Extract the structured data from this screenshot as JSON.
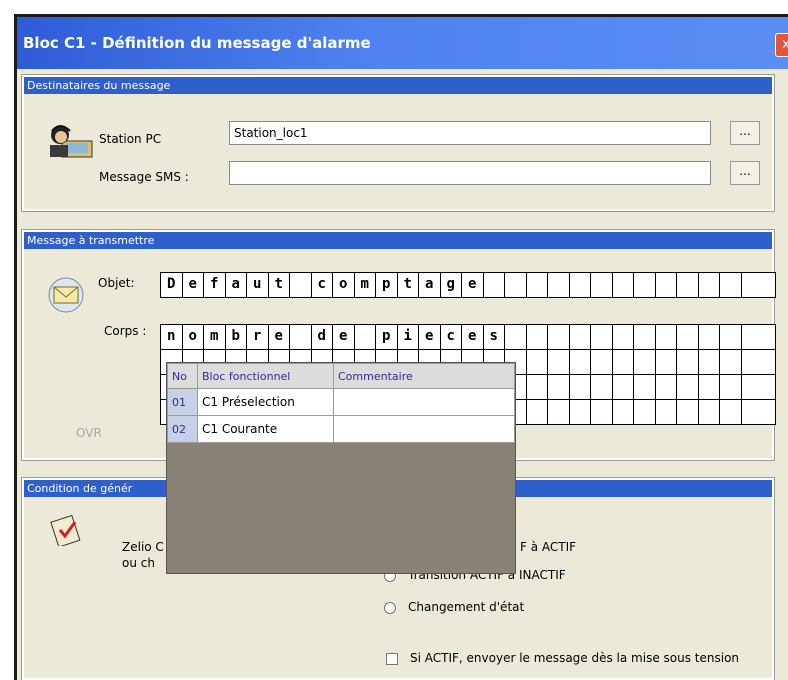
{
  "window": {
    "title": "Bloc C1 - Définition du message d'alarme",
    "close_glyph": "x"
  },
  "recipients": {
    "header": "Destinataires du message",
    "station_label": "Station PC",
    "station_value": "Station_loc1",
    "sms_label": "Message SMS :",
    "sms_value": "",
    "browse_label": "..."
  },
  "message": {
    "header": "Message à transmettre",
    "subject_label": "Objet:",
    "subject_chars": [
      "D",
      "e",
      "f",
      "a",
      "u",
      "t",
      " ",
      "c",
      "o",
      "m",
      "p",
      "t",
      "a",
      "g",
      "e",
      " ",
      " ",
      " ",
      " ",
      " ",
      " ",
      " ",
      " ",
      " ",
      " ",
      " ",
      " ",
      " "
    ],
    "body_label": "Corps :",
    "body_row1": [
      "n",
      "o",
      "m",
      "b",
      "r",
      "e",
      " ",
      "d",
      "e",
      " ",
      "p",
      "i",
      "e",
      "c",
      "e",
      "s",
      " ",
      " ",
      " ",
      " ",
      " ",
      " ",
      " ",
      " ",
      " ",
      " ",
      " ",
      " "
    ],
    "ovr_label": "OVR"
  },
  "condition": {
    "header": "Condition de génér",
    "zelio_text_1": "Zelio C",
    "zelio_text_2": "ou ch",
    "opt1": "F à ACTIF",
    "opt2": "Transition ACTIF à INACTIF",
    "opt3": "Changement d'état",
    "checkbox_label": "Si ACTIF, envoyer le message dès la mise sous tension"
  },
  "popup": {
    "columns": [
      "No",
      "Bloc fonctionnel",
      "Commentaire"
    ],
    "rows": [
      {
        "no": "01",
        "bloc": "C1 Préselection",
        "comment": ""
      },
      {
        "no": "02",
        "bloc": "C1 Courante",
        "comment": ""
      }
    ]
  },
  "colors": {
    "title_blue": "#2f5cd6",
    "header_blue": "#2e5fcb",
    "popup_bg": "#8a8274",
    "face": "#ece9d8"
  }
}
